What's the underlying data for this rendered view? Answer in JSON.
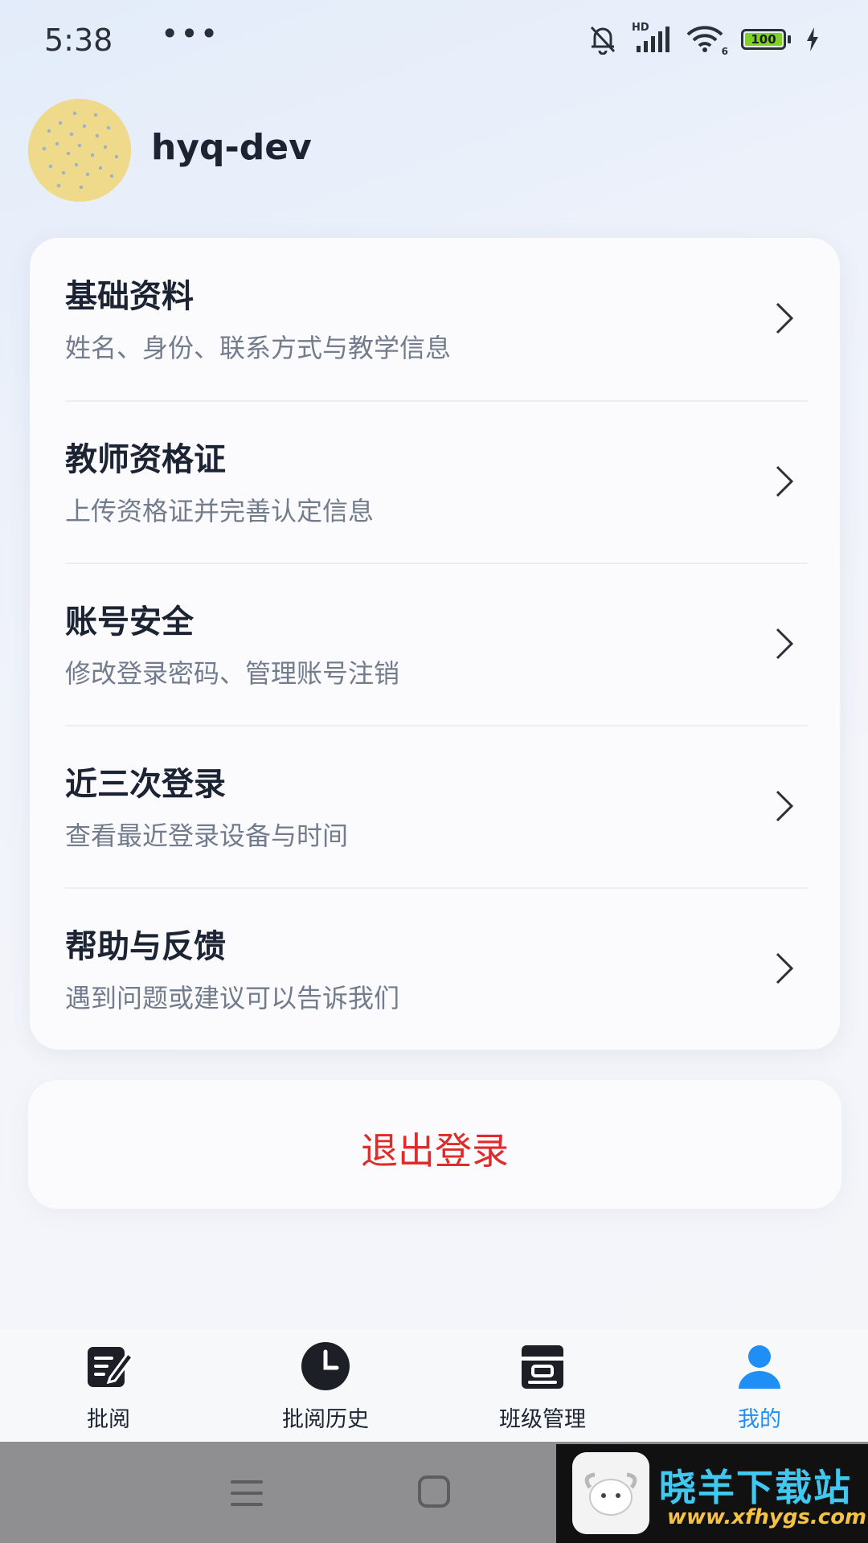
{
  "status_bar": {
    "time": "5:38",
    "dots": "•••",
    "battery": "100",
    "network_badge": "HD",
    "wifi_badge": "6"
  },
  "profile": {
    "username": "hyq-dev"
  },
  "menu": {
    "items": [
      {
        "title": "基础资料",
        "subtitle": "姓名、身份、联系方式与教学信息"
      },
      {
        "title": "教师资格证",
        "subtitle": "上传资格证并完善认定信息"
      },
      {
        "title": "账号安全",
        "subtitle": "修改登录密码、管理账号注销"
      },
      {
        "title": "近三次登录",
        "subtitle": "查看最近登录设备与时间"
      },
      {
        "title": "帮助与反馈",
        "subtitle": "遇到问题或建议可以告诉我们"
      }
    ]
  },
  "logout": {
    "label": "退出登录",
    "color": "#e02b2b"
  },
  "tabbar": {
    "tabs": [
      {
        "label": "批阅",
        "icon": "edit-doc-icon"
      },
      {
        "label": "批阅历史",
        "icon": "clock-icon"
      },
      {
        "label": "班级管理",
        "icon": "class-manage-icon"
      },
      {
        "label": "我的",
        "icon": "user-icon"
      }
    ],
    "active_index": 3,
    "active_color": "#1f8ff5"
  },
  "watermark": {
    "title": "晓羊下载站",
    "url": "www.xfhygs.com"
  }
}
